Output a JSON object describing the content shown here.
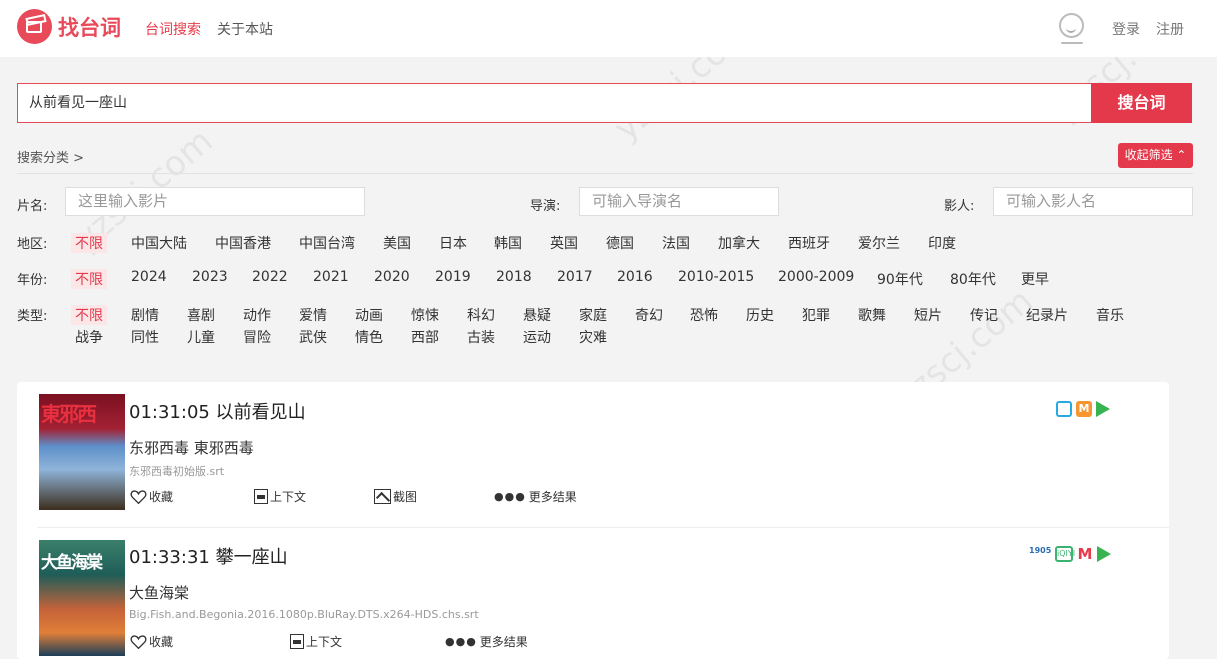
{
  "header": {
    "logo_text": "找台词",
    "nav": [
      "台词搜索",
      "关于本站"
    ],
    "login": "登录",
    "register": "注册"
  },
  "search": {
    "value": "从前看见一座山",
    "button": "搜台词"
  },
  "filters": {
    "category_label": "搜索分类 >",
    "collapse_label": "收起筛选 ⌃",
    "film_label": "片名:",
    "film_placeholder": "这里输入影片",
    "director_label": "导演:",
    "director_placeholder": "可输入导演名",
    "actor_label": "影人:",
    "actor_placeholder": "可输入影人名",
    "region_label": "地区:",
    "regions": [
      "不限",
      "中国大陆",
      "中国香港",
      "中国台湾",
      "美国",
      "日本",
      "韩国",
      "英国",
      "德国",
      "法国",
      "加拿大",
      "西班牙",
      "爱尔兰",
      "印度"
    ],
    "year_label": "年份:",
    "years": [
      "不限",
      "2024",
      "2023",
      "2022",
      "2021",
      "2020",
      "2019",
      "2018",
      "2017",
      "2016",
      "2010-2015",
      "2000-2009",
      "90年代",
      "80年代",
      "更早"
    ],
    "type_label": "类型:",
    "types_row1": [
      "不限",
      "剧情",
      "喜剧",
      "动作",
      "爱情",
      "动画",
      "惊悚",
      "科幻",
      "悬疑",
      "家庭",
      "奇幻",
      "恐怖",
      "历史",
      "犯罪",
      "歌舞",
      "短片",
      "传记",
      "纪录片",
      "音乐"
    ],
    "types_row2": [
      "战争",
      "同性",
      "儿童",
      "冒险",
      "武侠",
      "情色",
      "西部",
      "古装",
      "运动",
      "灾难"
    ]
  },
  "results": [
    {
      "poster_text": "東邪西",
      "title": "01:31:05 以前看见山",
      "subtitle": "东邪西毒 東邪西毒",
      "file": "东邪西毒初始版.srt",
      "actions": [
        "收藏",
        "上下文",
        "截图",
        "更多结果"
      ]
    },
    {
      "poster_text": "大鱼海棠",
      "title": "01:33:31 攀一座山",
      "subtitle": "大鱼海棠",
      "file": "Big.Fish.and.Begonia.2016.1080p.BluRay.DTS.x264-HDS.chs.srt",
      "actions": [
        "收藏",
        "上下文",
        "更多结果"
      ],
      "platform_1905": "1905",
      "platform_iq": "iQIYI"
    }
  ],
  "watermark": "yzscj.com",
  "colors": {
    "accent": "#e3394b",
    "background": "#f3f3f3"
  }
}
